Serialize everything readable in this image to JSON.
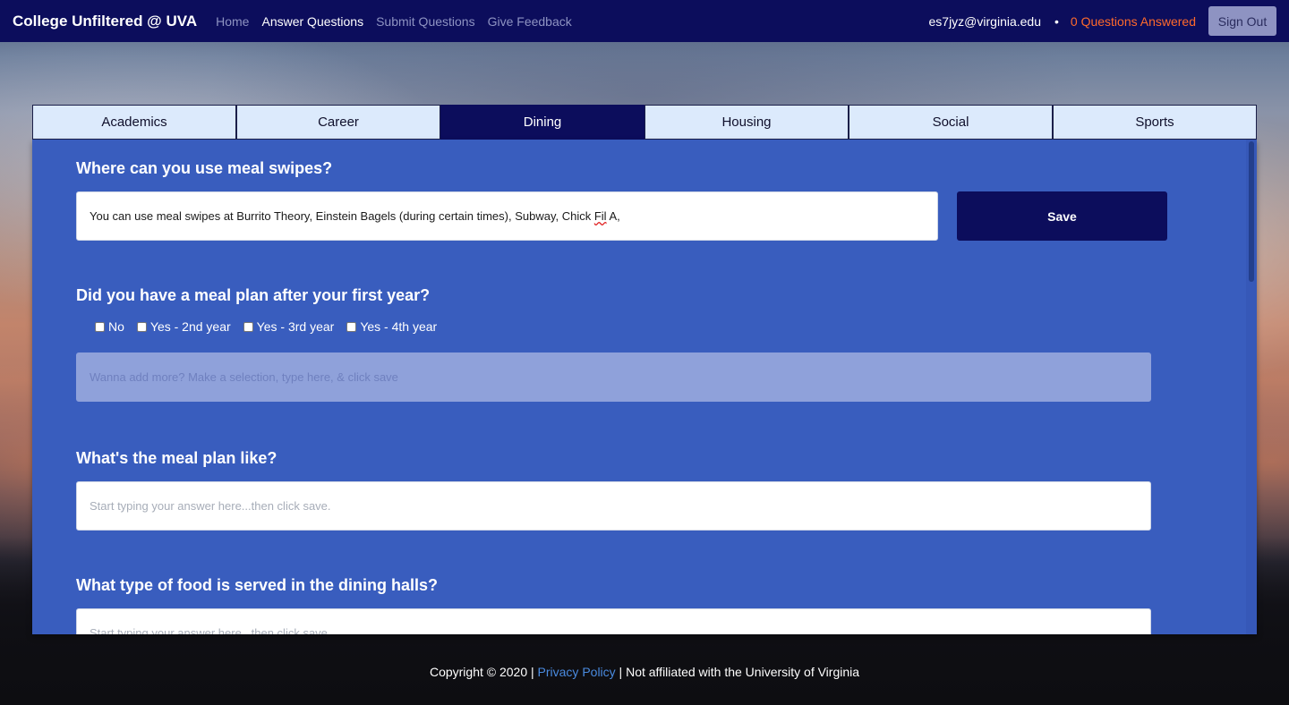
{
  "navbar": {
    "brand": "College Unfiltered @ UVA",
    "links": [
      {
        "label": "Home"
      },
      {
        "label": "Answer Questions"
      },
      {
        "label": "Submit Questions"
      },
      {
        "label": "Give Feedback"
      }
    ],
    "user_email": "es7jyz@virginia.edu",
    "separator": "•",
    "questions_answered": "0 Questions Answered",
    "sign_out_label": "Sign Out"
  },
  "tabs": [
    {
      "label": "Academics"
    },
    {
      "label": "Career"
    },
    {
      "label": "Dining"
    },
    {
      "label": "Housing"
    },
    {
      "label": "Social"
    },
    {
      "label": "Sports"
    }
  ],
  "active_tab": "Dining",
  "questions": [
    {
      "title": "Where can you use meal swipes?",
      "answer_prefix": "You can use meal swipes at Burrito Theory, Einstein Bagels (during certain times), Subway, Chick ",
      "answer_misspelled": "Fil",
      "answer_suffix": " A,",
      "save_label": "Save"
    },
    {
      "title": "Did you have a meal plan after your first year?",
      "options": [
        {
          "label": "No",
          "checked": false
        },
        {
          "label": "Yes - 2nd year",
          "checked": false
        },
        {
          "label": "Yes - 3rd year",
          "checked": false
        },
        {
          "label": "Yes - 4th year",
          "checked": false
        }
      ],
      "placeholder": "Wanna add more? Make a selection, type here, & click save"
    },
    {
      "title": "What's the meal plan like?",
      "placeholder": "Start typing your answer here...then click save."
    },
    {
      "title": "What type of food is served in the dining halls?",
      "placeholder": "Start typing your answer here...then click save."
    }
  ],
  "footer": {
    "copyright": "Copyright © 2020 | ",
    "privacy_link": "Privacy Policy",
    "disclaimer": " | Not affiliated with the University of Virginia"
  },
  "colors": {
    "navbar_bg": "#0c0d5c",
    "panel_bg": "#395dbe",
    "accent_orange": "#ff6a2b",
    "tab_inactive_bg": "#dceafc"
  }
}
